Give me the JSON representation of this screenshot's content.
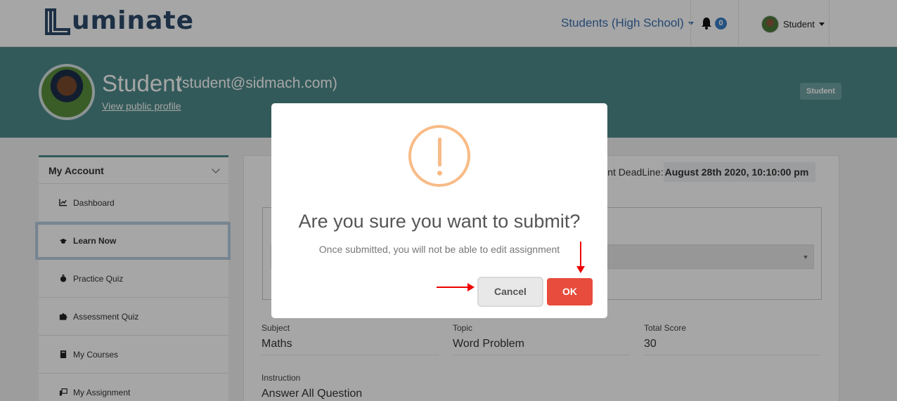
{
  "navbar": {
    "logo_text": "uminate",
    "role_selector": "Students (High School)",
    "notifications_count": "0",
    "user_label": "Student"
  },
  "banner": {
    "name": "Student",
    "email": "(student@sidmach.com)",
    "profile_link": "View public profile",
    "role_badge": "Student"
  },
  "sidebar": {
    "heading": "My Account",
    "items": [
      {
        "label": "Dashboard",
        "icon": "chart-line-icon"
      },
      {
        "label": "Learn Now",
        "icon": "graduation-cap-icon",
        "active": true
      },
      {
        "label": "Practice Quiz",
        "icon": "stopwatch-icon"
      },
      {
        "label": "Assessment Quiz",
        "icon": "puzzle-icon"
      },
      {
        "label": "My Courses",
        "icon": "book-icon"
      },
      {
        "label": "My Assignment",
        "icon": "teacher-board-icon"
      }
    ]
  },
  "main": {
    "deadline_label": "nment DeadLine:",
    "deadline_value": "August 28th 2020, 10:10:00 pm",
    "fields": {
      "subject_label": "Subject",
      "subject_value": "Maths",
      "topic_label": "Topic",
      "topic_value": "Word Problem",
      "score_label": "Total Score",
      "score_value": "30",
      "instruction_label": "Instruction",
      "instruction_value": "Answer All Question"
    }
  },
  "modal": {
    "title": "Are you sure you want to submit?",
    "text": "Once submitted, you will not be able to edit assignment",
    "cancel_label": "Cancel",
    "ok_label": "OK"
  },
  "colors": {
    "brand_teal": "#4f8a8b",
    "ok_red": "#e74c3c",
    "warning_orange": "#f8bb86",
    "link_blue": "#3a6fb0"
  }
}
